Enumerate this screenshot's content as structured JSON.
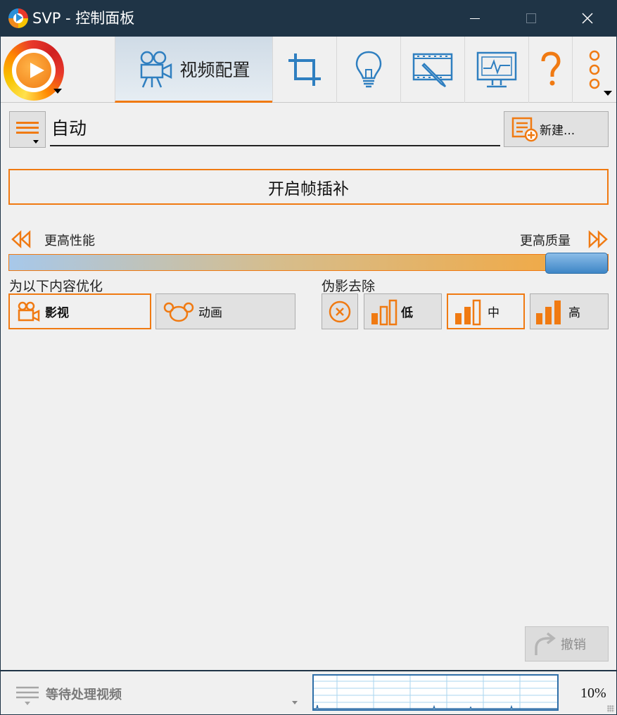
{
  "window": {
    "title": "SVP - 控制面板",
    "controls": [
      "minimize-icon",
      "maximize-icon",
      "close-icon"
    ]
  },
  "toolbar": {
    "logo_icon": "svp-logo-icon",
    "tabs": [
      {
        "label": "视频配置",
        "icon": "movie-camera-icon",
        "active": true
      },
      {
        "label": "",
        "icon": "crop-icon",
        "active": false
      },
      {
        "label": "",
        "icon": "lightbulb-icon",
        "active": false
      },
      {
        "label": "",
        "icon": "film-pen-icon",
        "active": false
      },
      {
        "label": "",
        "icon": "monitor-icon",
        "active": false
      },
      {
        "label": "",
        "icon": "question-icon",
        "active": false
      },
      {
        "label": "",
        "icon": "more-dots-icon",
        "active": false
      }
    ]
  },
  "profile": {
    "value": "自动",
    "menu_icon": "menu-lines-icon",
    "new_button": "新建..."
  },
  "interp_button": "开启帧插补",
  "slider": {
    "left_label": "更高性能",
    "right_label": "更高质量",
    "level": 0.95
  },
  "optimize": {
    "label": "为以下内容优化",
    "options": [
      {
        "label": "影视",
        "icon": "film-camera-icon",
        "selected": true
      },
      {
        "label": "动画",
        "icon": "cartoon-icon",
        "selected": false
      }
    ]
  },
  "artifact": {
    "label": "伪影去除",
    "options": [
      {
        "label": "",
        "icon": "cancel-circle-icon",
        "selected": false
      },
      {
        "label": "低",
        "icon": "bars-icon",
        "selected": false
      },
      {
        "label": "中",
        "icon": "bars-icon",
        "selected": true
      },
      {
        "label": "高",
        "icon": "bars-icon",
        "selected": false
      }
    ]
  },
  "undo_button": "撤销",
  "status": {
    "text": "等待处理视频",
    "cpu": "10%"
  },
  "colors": {
    "accent": "#f07a12",
    "title_bar": "#1f3446",
    "selection_blue": "#2f6fa8"
  }
}
